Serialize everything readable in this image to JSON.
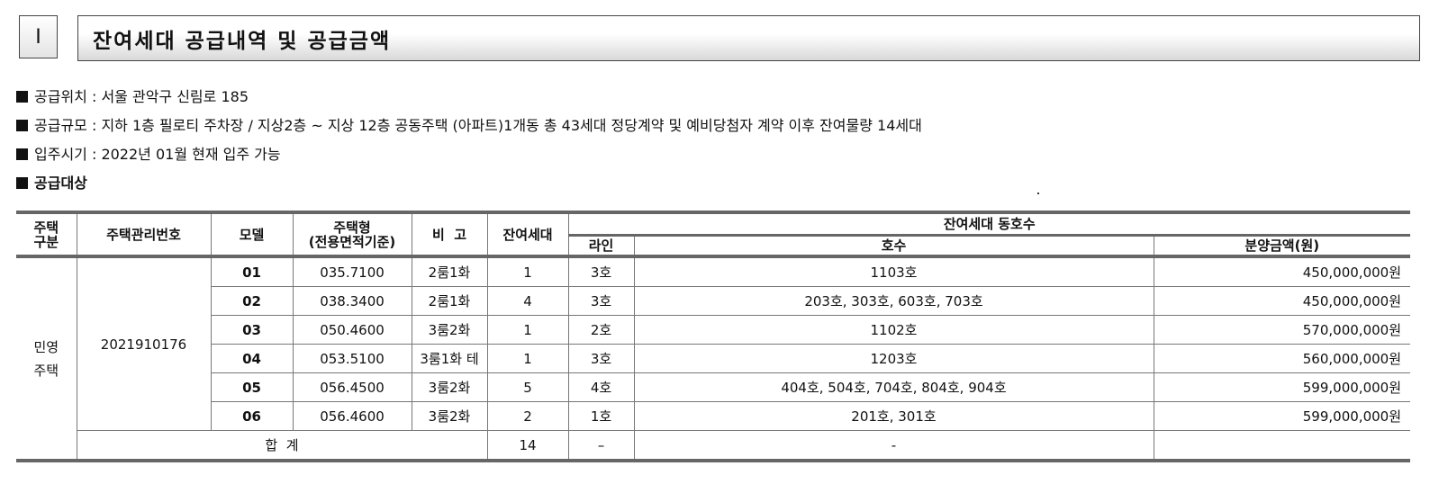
{
  "header": {
    "number": "Ⅰ",
    "title": "잔여세대 공급내역 및 공급금액"
  },
  "info": [
    "공급위치 : 서울 관악구 신림로 185",
    "공급규모 : 지하 1층 필로티 주차장 / 지상2층 ~ 지상 12층 공동주택 (아파트)1개동  총 43세대 정당계약 및 예비당첨자 계약 이후 잔여물량 14세대",
    "입주시기 : 2022년 01월 현재 입주 가능"
  ],
  "section_label": "공급대상",
  "table": {
    "headers": {
      "house_type": "주택\n구분",
      "mgmt_no": "주택관리번호",
      "model": "모델",
      "area": "주택형\n(전용면적기준)",
      "note": "비  고",
      "remain": "잔여세대",
      "group": "잔여세대 동호수",
      "line": "라인",
      "unit": "호수",
      "price": "분양금액(원)"
    },
    "house_type_value": "민영\n주택",
    "mgmt_no_value": "2021910176",
    "rows": [
      {
        "model": "01",
        "area": "035.7100",
        "note": "2룸1화",
        "remain": "1",
        "line": "3호",
        "unit": "1103호",
        "price": "450,000,000원"
      },
      {
        "model": "02",
        "area": "038.3400",
        "note": "2룸1화",
        "remain": "4",
        "line": "3호",
        "unit": "203호, 303호, 603호, 703호",
        "price": "450,000,000원"
      },
      {
        "model": "03",
        "area": "050.4600",
        "note": "3룸2화",
        "remain": "1",
        "line": "2호",
        "unit": "1102호",
        "price": "570,000,000원"
      },
      {
        "model": "04",
        "area": "053.5100",
        "note": "3룸1화 테",
        "remain": "1",
        "line": "3호",
        "unit": "1203호",
        "price": "560,000,000원"
      },
      {
        "model": "05",
        "area": "056.4500",
        "note": "3룸2화",
        "remain": "5",
        "line": "4호",
        "unit": "404호, 504호, 704호, 804호, 904호",
        "price": "599,000,000원"
      },
      {
        "model": "06",
        "area": "056.4600",
        "note": "3룸2화",
        "remain": "2",
        "line": "1호",
        "unit": "201호, 301호",
        "price": "599,000,000원"
      }
    ],
    "total": {
      "label": "합  계",
      "remain": "14",
      "line": "–",
      "unit": "-",
      "price": ""
    }
  }
}
